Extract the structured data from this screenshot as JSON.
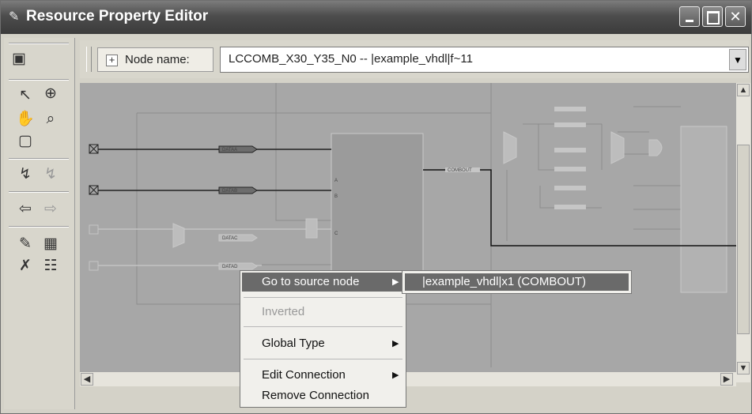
{
  "window": {
    "title": "Resource Property Editor"
  },
  "toolbar": {
    "node_name_label": "Node name:",
    "node_name_value": "LCCOMB_X30_Y35_N0 -- |example_vhdl|f~11"
  },
  "canvas": {
    "pin_labels": [
      "DATAA",
      "DATAB",
      "DATAC",
      "DATAD"
    ],
    "output_label": "COMBOUT",
    "port_labels": [
      "A",
      "B",
      "C"
    ]
  },
  "context_menu": {
    "items": [
      {
        "label": "Go to source node",
        "has_submenu": true,
        "highlighted": true
      },
      {
        "label": "Inverted",
        "disabled": true
      },
      {
        "label": "Global Type",
        "has_submenu": true
      },
      {
        "label": "Edit Connection",
        "has_submenu": true
      },
      {
        "label": "Remove Connection"
      }
    ],
    "submenu": {
      "label": "|example_vhdl|x1 (COMBOUT)"
    }
  }
}
